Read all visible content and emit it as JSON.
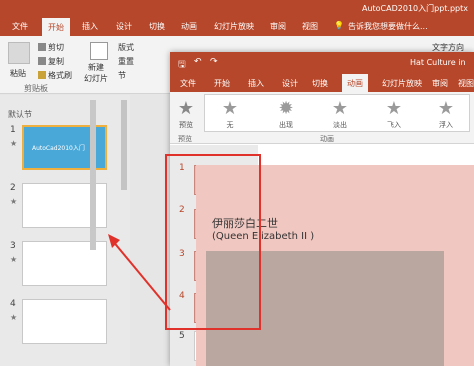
{
  "colors": {
    "accent": "#b7472a",
    "annotation": "#e0312b"
  },
  "back_window": {
    "title": "AutoCAD2010入门ppt.pptx",
    "tabs": [
      "文件",
      "开始",
      "插入",
      "设计",
      "切换",
      "动画",
      "幻灯片放映",
      "审阅",
      "视图"
    ],
    "active_tab": "开始",
    "search_hint": "告诉我您想要做什么...",
    "ribbon": {
      "paste": "粘贴",
      "cut": "剪切",
      "copy": "复制",
      "format_painter": "格式刷",
      "clipboard_group": "剪贴板",
      "new_slide": "新建\n幻灯片",
      "layout": "版式",
      "reset": "重置",
      "section": "节",
      "text_direction": "文字方向"
    },
    "section_label": "默认节",
    "slides": [
      {
        "num": "1"
      },
      {
        "num": "2"
      },
      {
        "num": "3"
      },
      {
        "num": "4"
      }
    ],
    "slide1_text": "AutoCad2010入门"
  },
  "front_window": {
    "title": "Hat Culture in",
    "tabs": [
      "文件",
      "开始",
      "插入",
      "设计",
      "切换",
      "动画",
      "幻灯片放映",
      "审阅",
      "视图"
    ],
    "active_tab": "动画",
    "ribbon": {
      "preview": "预览",
      "preview_group": "预览",
      "animation_group": "动画",
      "effects": [
        "无",
        "出现",
        "淡出",
        "飞入",
        "浮入"
      ]
    },
    "slides": [
      {
        "num": "1"
      },
      {
        "num": "2"
      },
      {
        "num": "3"
      },
      {
        "num": "4"
      },
      {
        "num": "5"
      }
    ],
    "slide_title_cn": "伊丽莎白二世",
    "slide_title_en": "(Queen Elizabeth II )"
  }
}
